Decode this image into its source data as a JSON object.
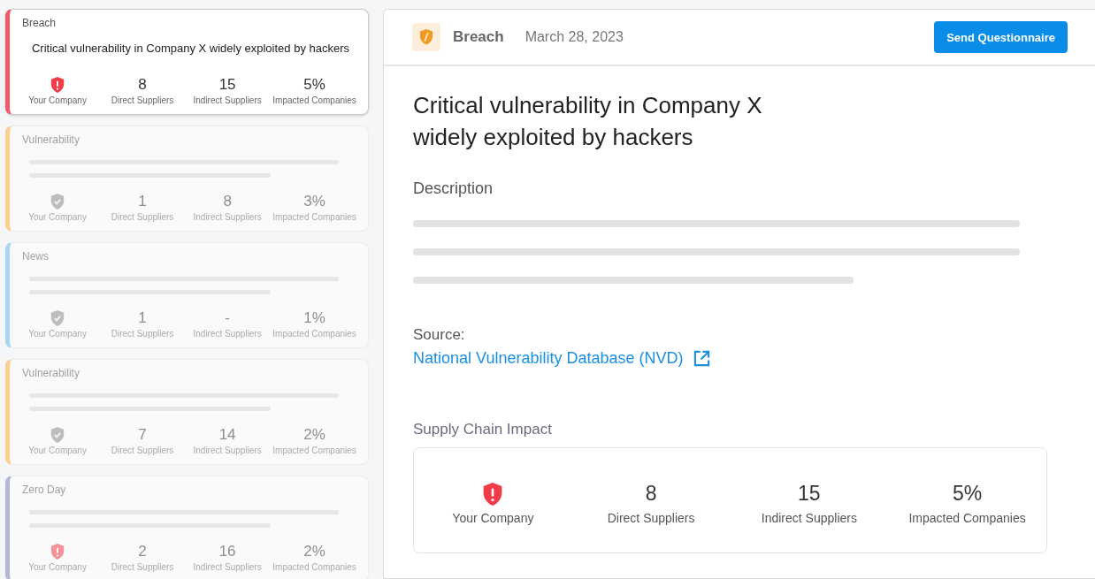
{
  "cards": [
    {
      "category": "Breach",
      "color": "#ef5b67",
      "selected": true,
      "headline": "Critical vulnerability in Company X widely exploited by hackers",
      "company": {
        "label": "Your Company",
        "alert": true
      },
      "stats": [
        {
          "value": "8",
          "label": "Direct Suppliers"
        },
        {
          "value": "15",
          "label": "Indirect Suppliers"
        },
        {
          "value": "5%",
          "label": "Impacted Companies"
        }
      ]
    },
    {
      "category": "Vulnerability",
      "color": "#fbd08f",
      "selected": false,
      "company": {
        "label": "Your Company",
        "alert": false
      },
      "stats": [
        {
          "value": "1",
          "label": "Direct Suppliers"
        },
        {
          "value": "8",
          "label": "Indirect Suppliers"
        },
        {
          "value": "3%",
          "label": "Impacted Companies"
        }
      ]
    },
    {
      "category": "News",
      "color": "#a9d6f5",
      "selected": false,
      "company": {
        "label": "Your Company",
        "alert": false
      },
      "stats": [
        {
          "value": "1",
          "label": "Direct Suppliers"
        },
        {
          "value": "-",
          "label": "Indirect Suppliers"
        },
        {
          "value": "1%",
          "label": "Impacted Companies"
        }
      ]
    },
    {
      "category": "Vulnerability",
      "color": "#fbd08f",
      "selected": false,
      "company": {
        "label": "Your Company",
        "alert": false
      },
      "stats": [
        {
          "value": "7",
          "label": "Direct Suppliers"
        },
        {
          "value": "14",
          "label": "Indirect Suppliers"
        },
        {
          "value": "2%",
          "label": "Impacted Companies"
        }
      ]
    },
    {
      "category": "Zero Day",
      "color": "#b4b6d6",
      "selected": false,
      "company": {
        "label": "Your Company",
        "alert": true
      },
      "stats": [
        {
          "value": "2",
          "label": "Direct Suppliers"
        },
        {
          "value": "16",
          "label": "Indirect Suppliers"
        },
        {
          "value": "2%",
          "label": "Impacted Companies"
        }
      ]
    }
  ],
  "detail": {
    "category": "Breach",
    "date": "March 28, 2023",
    "button": "Send Questionnaire",
    "title": "Critical vulnerability in Company X widely exploited by hackers",
    "description_label": "Description",
    "source_label": "Source:",
    "source_link": "National Vulnerability Database (NVD)",
    "impact_label": "Supply Chain Impact",
    "company": {
      "label": "Your Company",
      "alert": true
    },
    "stats": [
      {
        "value": "8",
        "label": "Direct Suppliers"
      },
      {
        "value": "15",
        "label": "Indirect Suppliers"
      },
      {
        "value": "5%",
        "label": "Impacted Companies"
      }
    ]
  }
}
